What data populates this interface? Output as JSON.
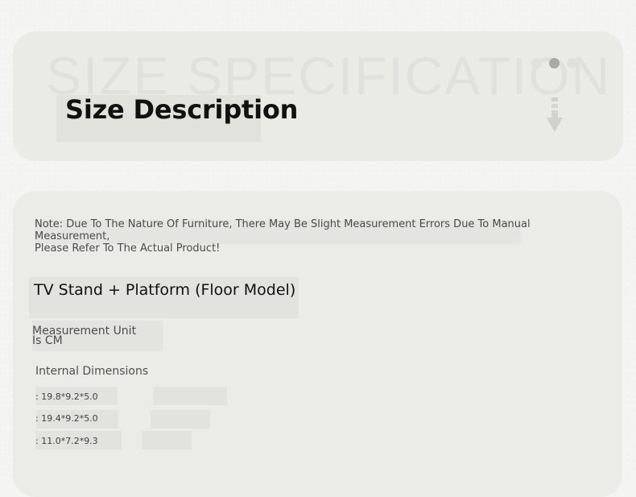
{
  "header": {
    "watermark": "SIZE SPECIFICATION",
    "title": "Size Description",
    "carousel": {
      "count": 3,
      "active_index": 1
    },
    "icon": "down-arrow-icon"
  },
  "content": {
    "note": "Note: Due To The Nature Of Furniture, There May Be Slight Measurement Errors Due To Manual Measurement,\nPlease Refer To The Actual Product!",
    "section_title": "TV Stand + Platform (Floor Model)",
    "unit_label": "Measurement Unit\nIs CM",
    "dimensions_heading": "Internal Dimensions",
    "dimensions": [
      ": 19.8*9.2*5.0",
      ": 19.4*9.2*5.0",
      ": 11.0*7.2*9.3"
    ]
  },
  "colors": {
    "background": "#f4f4f2",
    "card": "#ebebe6",
    "title": "#111111",
    "active_dot": "#a8a8a6"
  }
}
